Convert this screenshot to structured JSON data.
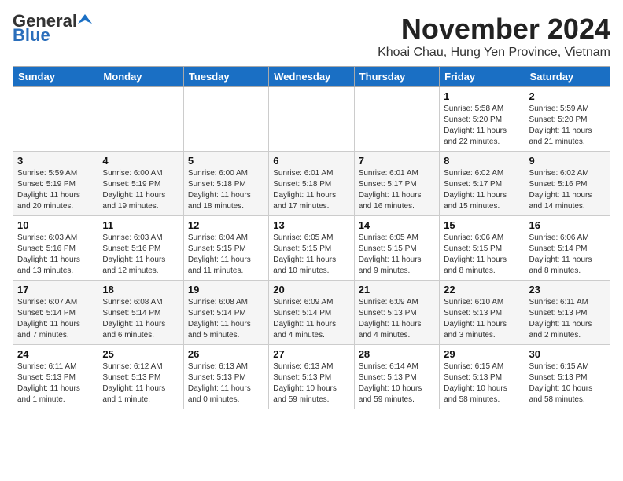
{
  "logo": {
    "general": "General",
    "blue": "Blue"
  },
  "header": {
    "month_title": "November 2024",
    "location": "Khoai Chau, Hung Yen Province, Vietnam"
  },
  "weekdays": [
    "Sunday",
    "Monday",
    "Tuesday",
    "Wednesday",
    "Thursday",
    "Friday",
    "Saturday"
  ],
  "weeks": [
    [
      {
        "day": "",
        "info": ""
      },
      {
        "day": "",
        "info": ""
      },
      {
        "day": "",
        "info": ""
      },
      {
        "day": "",
        "info": ""
      },
      {
        "day": "",
        "info": ""
      },
      {
        "day": "1",
        "info": "Sunrise: 5:58 AM\nSunset: 5:20 PM\nDaylight: 11 hours\nand 22 minutes."
      },
      {
        "day": "2",
        "info": "Sunrise: 5:59 AM\nSunset: 5:20 PM\nDaylight: 11 hours\nand 21 minutes."
      }
    ],
    [
      {
        "day": "3",
        "info": "Sunrise: 5:59 AM\nSunset: 5:19 PM\nDaylight: 11 hours\nand 20 minutes."
      },
      {
        "day": "4",
        "info": "Sunrise: 6:00 AM\nSunset: 5:19 PM\nDaylight: 11 hours\nand 19 minutes."
      },
      {
        "day": "5",
        "info": "Sunrise: 6:00 AM\nSunset: 5:18 PM\nDaylight: 11 hours\nand 18 minutes."
      },
      {
        "day": "6",
        "info": "Sunrise: 6:01 AM\nSunset: 5:18 PM\nDaylight: 11 hours\nand 17 minutes."
      },
      {
        "day": "7",
        "info": "Sunrise: 6:01 AM\nSunset: 5:17 PM\nDaylight: 11 hours\nand 16 minutes."
      },
      {
        "day": "8",
        "info": "Sunrise: 6:02 AM\nSunset: 5:17 PM\nDaylight: 11 hours\nand 15 minutes."
      },
      {
        "day": "9",
        "info": "Sunrise: 6:02 AM\nSunset: 5:16 PM\nDaylight: 11 hours\nand 14 minutes."
      }
    ],
    [
      {
        "day": "10",
        "info": "Sunrise: 6:03 AM\nSunset: 5:16 PM\nDaylight: 11 hours\nand 13 minutes."
      },
      {
        "day": "11",
        "info": "Sunrise: 6:03 AM\nSunset: 5:16 PM\nDaylight: 11 hours\nand 12 minutes."
      },
      {
        "day": "12",
        "info": "Sunrise: 6:04 AM\nSunset: 5:15 PM\nDaylight: 11 hours\nand 11 minutes."
      },
      {
        "day": "13",
        "info": "Sunrise: 6:05 AM\nSunset: 5:15 PM\nDaylight: 11 hours\nand 10 minutes."
      },
      {
        "day": "14",
        "info": "Sunrise: 6:05 AM\nSunset: 5:15 PM\nDaylight: 11 hours\nand 9 minutes."
      },
      {
        "day": "15",
        "info": "Sunrise: 6:06 AM\nSunset: 5:15 PM\nDaylight: 11 hours\nand 8 minutes."
      },
      {
        "day": "16",
        "info": "Sunrise: 6:06 AM\nSunset: 5:14 PM\nDaylight: 11 hours\nand 8 minutes."
      }
    ],
    [
      {
        "day": "17",
        "info": "Sunrise: 6:07 AM\nSunset: 5:14 PM\nDaylight: 11 hours\nand 7 minutes."
      },
      {
        "day": "18",
        "info": "Sunrise: 6:08 AM\nSunset: 5:14 PM\nDaylight: 11 hours\nand 6 minutes."
      },
      {
        "day": "19",
        "info": "Sunrise: 6:08 AM\nSunset: 5:14 PM\nDaylight: 11 hours\nand 5 minutes."
      },
      {
        "day": "20",
        "info": "Sunrise: 6:09 AM\nSunset: 5:14 PM\nDaylight: 11 hours\nand 4 minutes."
      },
      {
        "day": "21",
        "info": "Sunrise: 6:09 AM\nSunset: 5:13 PM\nDaylight: 11 hours\nand 4 minutes."
      },
      {
        "day": "22",
        "info": "Sunrise: 6:10 AM\nSunset: 5:13 PM\nDaylight: 11 hours\nand 3 minutes."
      },
      {
        "day": "23",
        "info": "Sunrise: 6:11 AM\nSunset: 5:13 PM\nDaylight: 11 hours\nand 2 minutes."
      }
    ],
    [
      {
        "day": "24",
        "info": "Sunrise: 6:11 AM\nSunset: 5:13 PM\nDaylight: 11 hours\nand 1 minute."
      },
      {
        "day": "25",
        "info": "Sunrise: 6:12 AM\nSunset: 5:13 PM\nDaylight: 11 hours\nand 1 minute."
      },
      {
        "day": "26",
        "info": "Sunrise: 6:13 AM\nSunset: 5:13 PM\nDaylight: 11 hours\nand 0 minutes."
      },
      {
        "day": "27",
        "info": "Sunrise: 6:13 AM\nSunset: 5:13 PM\nDaylight: 10 hours\nand 59 minutes."
      },
      {
        "day": "28",
        "info": "Sunrise: 6:14 AM\nSunset: 5:13 PM\nDaylight: 10 hours\nand 59 minutes."
      },
      {
        "day": "29",
        "info": "Sunrise: 6:15 AM\nSunset: 5:13 PM\nDaylight: 10 hours\nand 58 minutes."
      },
      {
        "day": "30",
        "info": "Sunrise: 6:15 AM\nSunset: 5:13 PM\nDaylight: 10 hours\nand 58 minutes."
      }
    ]
  ]
}
